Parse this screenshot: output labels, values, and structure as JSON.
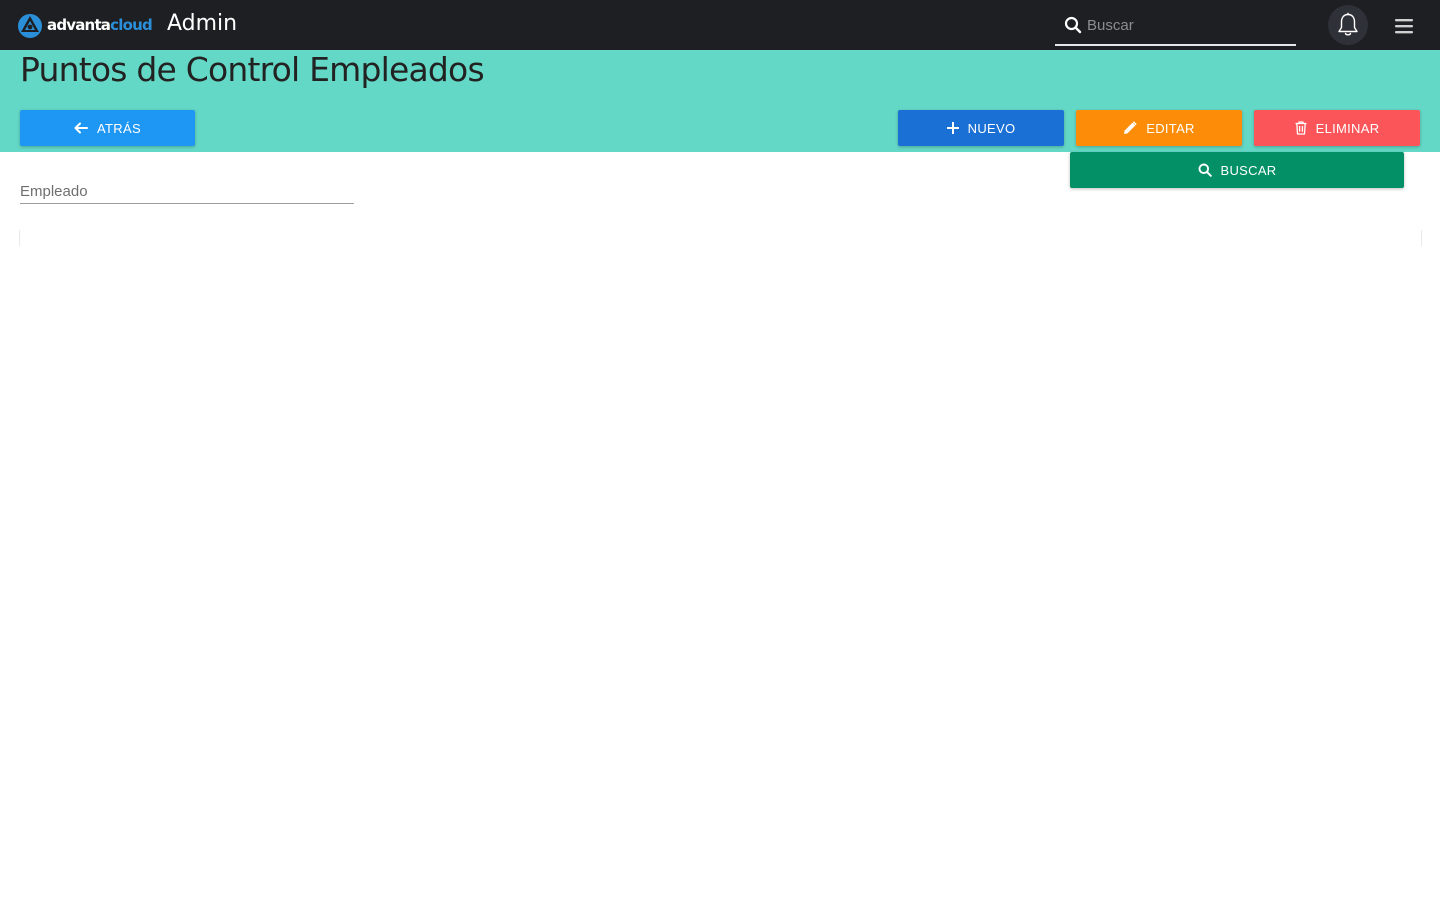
{
  "header": {
    "logo_text_main": "advanta",
    "logo_text_accent": "cloud",
    "app_name": "Admin",
    "search_placeholder": "Buscar",
    "notifications_icon": "bell-icon",
    "menu_icon": "hamburger-menu-icon"
  },
  "page": {
    "title": "Puntos de Control Empleados"
  },
  "toolbar": {
    "back_label": "ATRÁS",
    "new_label": "NUEVO",
    "edit_label": "EDITAR",
    "delete_label": "ELIMINAR",
    "search_label": "BUSCAR"
  },
  "filters": {
    "employee_placeholder": "Empleado"
  },
  "colors": {
    "topbar": "#1e1f22",
    "banner": "#64d8c6",
    "back": "#1e96f3",
    "new": "#1a70d4",
    "edit": "#fd8c09",
    "delete": "#fb5559",
    "search": "#039066"
  }
}
